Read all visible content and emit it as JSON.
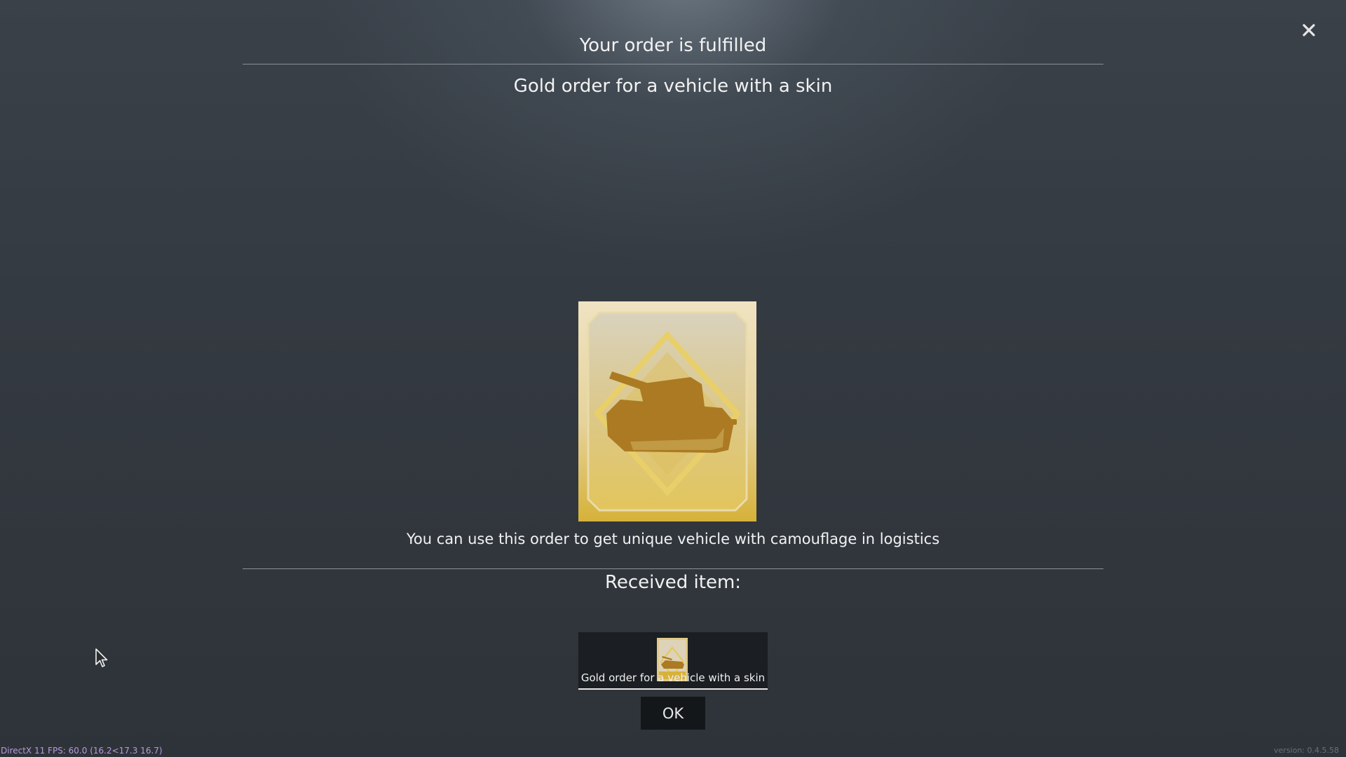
{
  "dialog": {
    "title": "Your order is fulfilled",
    "subtitle": "Gold order for a vehicle with a skin",
    "description": "You can use this order to get unique vehicle with camouflage in logistics",
    "received_label": "Received item:",
    "close_icon": "close-icon"
  },
  "received_item": {
    "label": "Gold order for a vehicle with a skin",
    "icon": "gold-order-tank-icon"
  },
  "buttons": {
    "ok_label": "OK"
  },
  "overlay": {
    "fps_text": "DirectX 11 FPS: 60.0 (16.2<17.3 16.7)",
    "version_text": "version: 0.4.5.58"
  },
  "colors": {
    "gold_light": "#e8dcb8",
    "gold": "#d4b24a",
    "tank_silhouette": "#b07e24",
    "background": "#343a41"
  }
}
